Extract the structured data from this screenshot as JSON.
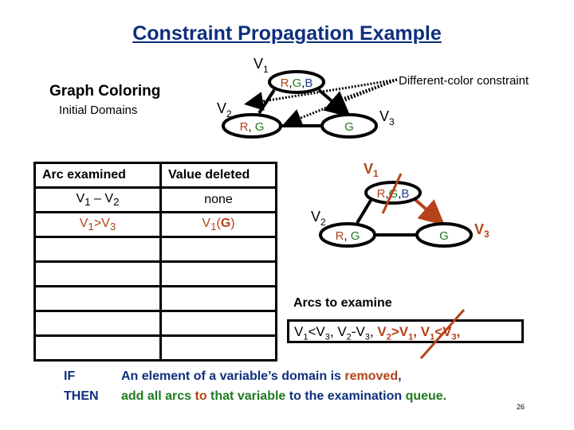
{
  "title": "Constraint Propagation Example",
  "left_panel": {
    "heading": "Graph Coloring",
    "subheading": "Initial Domains"
  },
  "legend": {
    "dotted_line_label": "Different-color constraint"
  },
  "colors": {
    "title": "#0e2f7c",
    "red": "#b5421a",
    "green": "#1f7a21",
    "blue": "#1d3f8c"
  },
  "top_graph": {
    "nodes": [
      {
        "id": "V1",
        "name": "V",
        "sub": "1",
        "domain": [
          "R",
          "G",
          "B"
        ]
      },
      {
        "id": "V2",
        "name": "V",
        "sub": "2",
        "domain": [
          "R",
          "G"
        ]
      },
      {
        "id": "V3",
        "name": "V",
        "sub": "3",
        "domain": [
          "G"
        ]
      }
    ],
    "edges": [
      [
        "V1",
        "V2"
      ],
      [
        "V1",
        "V3"
      ],
      [
        "V2",
        "V3"
      ]
    ]
  },
  "bottom_graph": {
    "nodes": [
      {
        "id": "V1",
        "name": "V",
        "sub": "1",
        "domain": [
          "R",
          "G",
          "B"
        ],
        "removed": "G"
      },
      {
        "id": "V2",
        "name": "V",
        "sub": "2",
        "domain": [
          "R",
          "G"
        ]
      },
      {
        "id": "V3",
        "name": "V",
        "sub": "3",
        "domain": [
          "G"
        ]
      }
    ],
    "highlighted_arc": [
      "V1",
      "V3"
    ]
  },
  "table": {
    "headers": [
      "Arc  examined",
      "Value deleted"
    ],
    "rows": [
      {
        "arc_a": "V",
        "arc_a_sub": "1",
        "op": " – ",
        "arc_b": "V",
        "arc_b_sub": "2",
        "deleted": "none",
        "highlight": false
      },
      {
        "arc_a": "V",
        "arc_a_sub": "1",
        "op": ">",
        "arc_b": "V",
        "arc_b_sub": "3",
        "deleted_var": "V",
        "deleted_sub": "1",
        "deleted_val": "G",
        "highlight": true
      }
    ],
    "empty_rows": 5
  },
  "arcs_to_examine": {
    "label": "Arcs to examine",
    "items": [
      {
        "text": "V1<V3",
        "a_sub": "1",
        "op": "<",
        "b_sub": "3",
        "style": "normal"
      },
      {
        "text": "V2-V3",
        "a_sub": "2",
        "op": "-",
        "b_sub": "3",
        "style": "normal"
      },
      {
        "text": "V2>V1",
        "a_sub": "2",
        "op": ">",
        "b_sub": "1",
        "style": "added"
      },
      {
        "text": "V1<V3",
        "a_sub": "1",
        "op": "<",
        "b_sub": "3",
        "style": "added-struck"
      }
    ]
  },
  "rule": {
    "if_label": "IF",
    "then_label": "THEN",
    "line1": {
      "pre": "An element of a variable’s domain is ",
      "highlight": "removed",
      "post": ","
    },
    "line2": {
      "p1": "add all arcs ",
      "p2": "to",
      "p3": " that variable",
      "p4": " to the examination ",
      "p5": "queue."
    }
  },
  "page_number": "26"
}
